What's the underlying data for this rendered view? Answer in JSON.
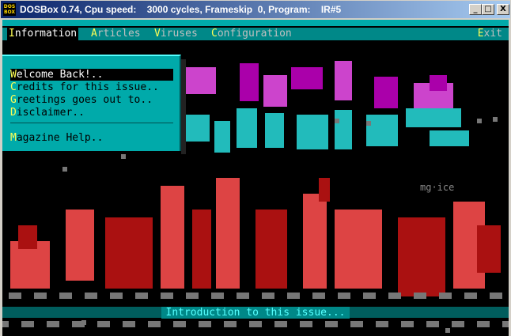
{
  "window": {
    "icon_label": "DOS\nBOX",
    "title": "DOSBox 0.74, Cpu speed:    3000 cycles, Frameskip  0, Program:    IR#5",
    "min_label": "_",
    "max_label": "□",
    "close_label": "X"
  },
  "menubar": {
    "items": [
      {
        "hot": "I",
        "rest": "nformation"
      },
      {
        "hot": "A",
        "rest": "rticles"
      },
      {
        "hot": "V",
        "rest": "iruses"
      },
      {
        "hot": "C",
        "rest": "onfiguration"
      }
    ],
    "exit": {
      "hot": "E",
      "rest": "xit"
    }
  },
  "dropdown": {
    "items": [
      {
        "hot": "W",
        "rest": "elcome Back!.."
      },
      {
        "hot": "C",
        "rest": "redits for this issue.."
      },
      {
        "hot": "G",
        "rest": "reetings goes out to.."
      },
      {
        "hot": "D",
        "rest": "isclaimer.."
      },
      {
        "hot": "M",
        "rest": "agazine Help.."
      }
    ]
  },
  "art": {
    "artist_tag": "mg·ice",
    "colors": {
      "magenta": "#aa00aa",
      "magenta_light": "#cc44cc",
      "cyan": "#22bbbb",
      "red": "#aa1111",
      "red_light": "#dd4444",
      "grey": "#777777"
    }
  },
  "status": {
    "text": "Introduction to this issue..."
  }
}
